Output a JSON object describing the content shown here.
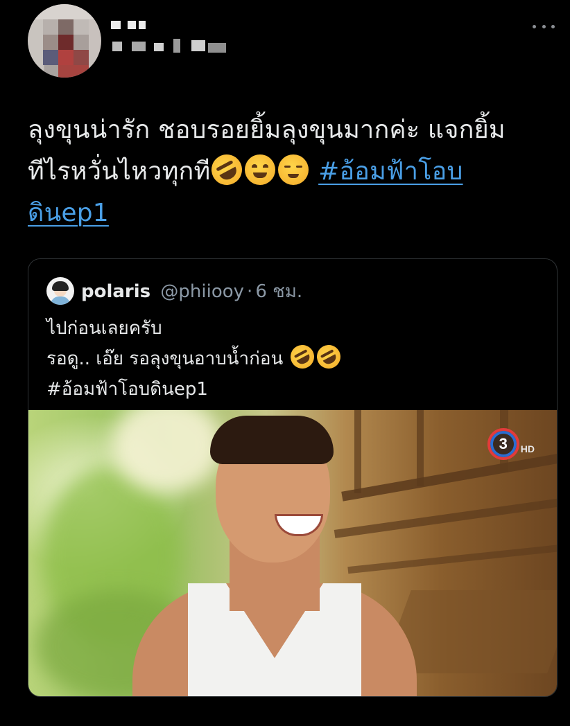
{
  "tweet": {
    "text_line1": "ลุงขุนน่ารัก ชอบรอยยิ้มลุงขุนมากค่ะ แจกยิ้ม",
    "text_line2": "ทีไรหวั่นไหวทุกที",
    "emojis_line2": [
      "rolling-on-floor-laughing",
      "smiling-face-with-smiling-eyes",
      "smiling-face"
    ],
    "hashtag_part1": "#อ้อมฟ้าโอบ",
    "hashtag_part2": "ดินep1"
  },
  "quoted_tweet": {
    "name": "polaris",
    "handle": "@phiiooy",
    "separator": "·",
    "time": "6 ชม.",
    "line1": "ไปก่อนเลยครับ",
    "line2": "รอดู.. เอ๊ย รอลุงขุนอาบน้ำก่อน",
    "line2_emojis": [
      "rolling-on-floor-laughing",
      "rolling-on-floor-laughing"
    ],
    "line3": "#อ้อมฟ้าโอบดินep1"
  },
  "media": {
    "channel_logo_number": "3",
    "channel_logo_suffix": "HD"
  },
  "colors": {
    "background": "#000000",
    "text": "#e7e9ea",
    "secondary_text": "#8b98a5",
    "hashtag": "#4a9fe6",
    "card_border": "#2f3336"
  },
  "icons": {
    "more": "more-horizontal-icon"
  }
}
